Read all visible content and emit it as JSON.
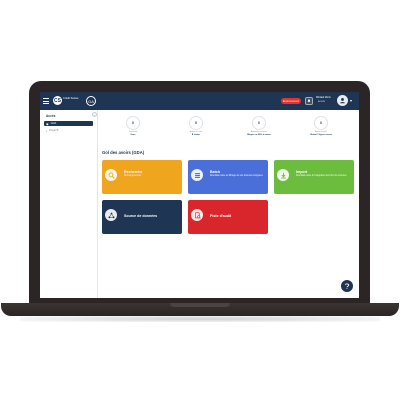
{
  "header": {
    "logo_mark": "CS",
    "logo_text": "Crédit Suisse",
    "app_mark": "GA",
    "env_badge": "Environnement",
    "notif_icon": "bell-icon",
    "user_name": "Mickaël Morin",
    "user_role": "ADMIN",
    "chevron": "▾"
  },
  "sidebar": {
    "title": "Accès",
    "collapse_glyph": "‹",
    "items": [
      {
        "label": "GDA",
        "active": true
      },
      {
        "label": "Projet B",
        "active": false
      }
    ]
  },
  "stats": [
    {
      "value": "0",
      "sub": "Total traité",
      "label": "Gars"
    },
    {
      "value": "0",
      "sub": "Actions à traiter",
      "label": "À traiter"
    },
    {
      "value": "0",
      "sub": "Anomalies restantes",
      "label": "Mégas en 60% à traiter"
    },
    {
      "value": "0",
      "sub": "Avoirs restants",
      "label": "Global / Hyper ouvert"
    }
  ],
  "section_title": "Gol des avoirs (GDA)",
  "cards": [
    {
      "title": "Recherche",
      "desc": "Renseignements",
      "color": "#f0a51f",
      "icon": "search-icon"
    },
    {
      "title": "Batch",
      "desc": "Résultats suite au filtrage de vos données intégrées",
      "color": "#4b6fd8",
      "icon": "batch-icon"
    },
    {
      "title": "Import",
      "desc": "Résultats suite à l'intégration des flux de données",
      "color": "#6cbd3e",
      "icon": "import-icon"
    },
    {
      "title": "Source de données",
      "desc": "",
      "color": "#1e3553",
      "icon": "network-icon"
    },
    {
      "title": "Piste d'audit",
      "desc": "",
      "color": "#d9262c",
      "icon": "audit-icon"
    }
  ],
  "fab_icon": "help-icon"
}
